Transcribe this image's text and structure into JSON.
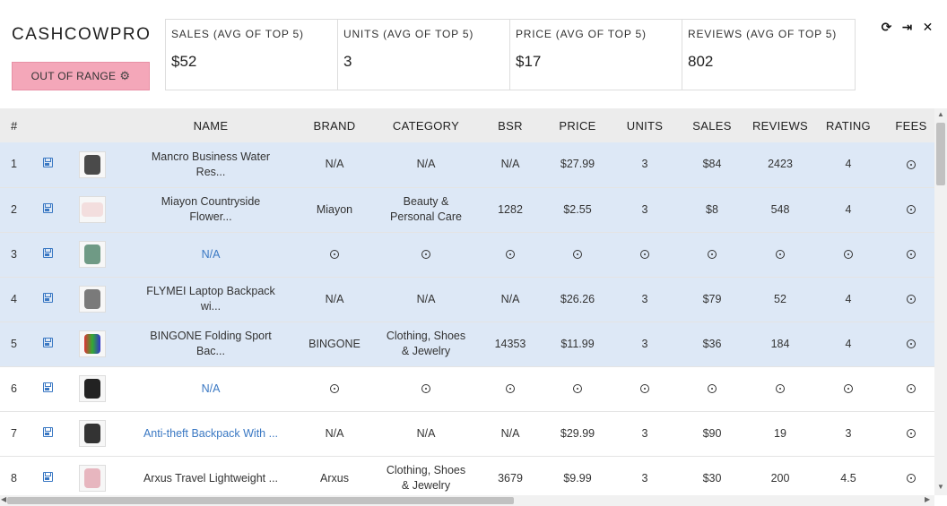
{
  "app": {
    "logo": "CASHCOWPRO",
    "range_button": "OUT OF RANGE",
    "range_icon": "gears-icon"
  },
  "stats": [
    {
      "label": "SALES (AVG OF TOP 5)",
      "value": "$52"
    },
    {
      "label": "UNITS (AVG OF TOP 5)",
      "value": "3"
    },
    {
      "label": "PRICE (AVG OF TOP 5)",
      "value": "$17"
    },
    {
      "label": "REVIEWS (AVG OF TOP 5)",
      "value": "802"
    }
  ],
  "window_controls": {
    "refresh": "⟳",
    "export": "⇥",
    "close": "✕"
  },
  "table": {
    "headers": {
      "num": "#",
      "name": "NAME",
      "brand": "BRAND",
      "category": "CATEGORY",
      "bsr": "BSR",
      "price": "PRICE",
      "units": "UNITS",
      "sales": "SALES",
      "reviews": "REVIEWS",
      "rating": "RATING",
      "fees": "FEES"
    },
    "rows": [
      {
        "num": "1",
        "name_l1": "Mancro Business Water",
        "name_l2": "Res...",
        "brand": "N/A",
        "cat_l1": "N/A",
        "cat_l2": "",
        "bsr": "N/A",
        "price": "$27.99",
        "units": "3",
        "sales": "$84",
        "reviews": "2423",
        "rating": "4"
      },
      {
        "num": "2",
        "name_l1": "Miayon Countryside",
        "name_l2": "Flower...",
        "brand": "Miayon",
        "cat_l1": "Beauty &",
        "cat_l2": "Personal Care",
        "bsr": "1282",
        "price": "$2.55",
        "units": "3",
        "sales": "$8",
        "reviews": "548",
        "rating": "4"
      },
      {
        "num": "3",
        "name_l1": "N/A",
        "name_l2": ""
      },
      {
        "num": "4",
        "name_l1": "FLYMEI Laptop Backpack",
        "name_l2": "wi...",
        "brand": "N/A",
        "cat_l1": "N/A",
        "cat_l2": "",
        "bsr": "N/A",
        "price": "$26.26",
        "units": "3",
        "sales": "$79",
        "reviews": "52",
        "rating": "4"
      },
      {
        "num": "5",
        "name_l1": "BINGONE Folding Sport",
        "name_l2": "Bac...",
        "brand": "BINGONE",
        "cat_l1": "Clothing, Shoes",
        "cat_l2": "& Jewelry",
        "bsr": "14353",
        "price": "$11.99",
        "units": "3",
        "sales": "$36",
        "reviews": "184",
        "rating": "4"
      },
      {
        "num": "6",
        "name_l1": "N/A",
        "name_l2": ""
      },
      {
        "num": "7",
        "name_l1": "Anti-theft Backpack With ...",
        "name_l2": "",
        "brand": "N/A",
        "cat_l1": "N/A",
        "cat_l2": "",
        "bsr": "N/A",
        "price": "$29.99",
        "units": "3",
        "sales": "$90",
        "reviews": "19",
        "rating": "3"
      },
      {
        "num": "8",
        "name_l1": "Arxus Travel Lightweight ...",
        "name_l2": "",
        "brand": "Arxus",
        "cat_l1": "Clothing, Shoes",
        "cat_l2": "& Jewelry",
        "bsr": "3679",
        "price": "$9.99",
        "units": "3",
        "sales": "$30",
        "reviews": "200",
        "rating": "4.5"
      }
    ]
  },
  "colors": {
    "highlight_row": "#dde8f6",
    "range_button": "#f4a7b9",
    "link": "#3a78c3"
  }
}
